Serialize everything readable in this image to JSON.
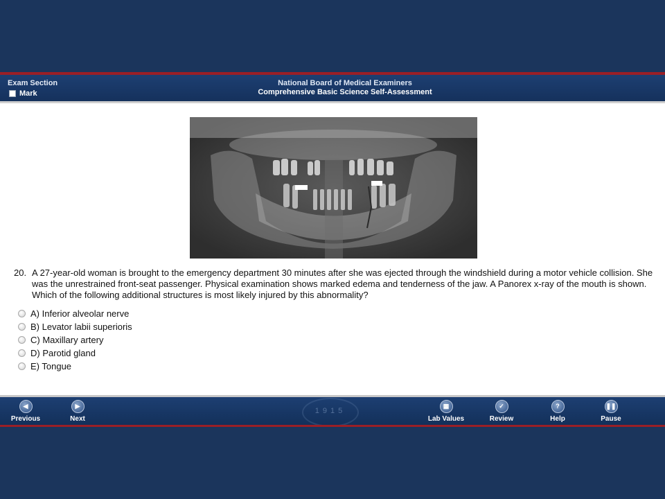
{
  "header": {
    "exam_section": "Exam Section",
    "mark_label": "Mark",
    "title_line1": "National Board of Medical Examiners",
    "title_line2": "Comprehensive Basic Science Self-Assessment"
  },
  "question": {
    "number": "20.",
    "stem": "A 27-year-old woman is brought to the emergency department 30 minutes after she was ejected through the windshield during a motor vehicle collision. She was the unrestrained front-seat passenger. Physical examination shows marked edema and tenderness of the jaw. A Panorex x-ray of the mouth is shown. Which of the following additional structures is most likely injured by this abnormality?",
    "options": [
      "A) Inferior alveolar nerve",
      "B) Levator labii superioris",
      "C) Maxillary artery",
      "D) Parotid gland",
      "E) Tongue"
    ]
  },
  "footer": {
    "previous": "Previous",
    "next": "Next",
    "lab_values": "Lab Values",
    "review": "Review",
    "help": "Help",
    "pause": "Pause",
    "seal_text": "1915"
  },
  "icons": {
    "previous": "chevron-left-icon",
    "next": "chevron-right-icon",
    "lab_values": "lab-values-icon",
    "review": "checkmark-icon",
    "help": "question-mark-icon",
    "pause": "pause-icon"
  },
  "colors": {
    "background": "#1b355c",
    "header_bar": "#1d3f72",
    "accent_red": "#9a1f26"
  }
}
